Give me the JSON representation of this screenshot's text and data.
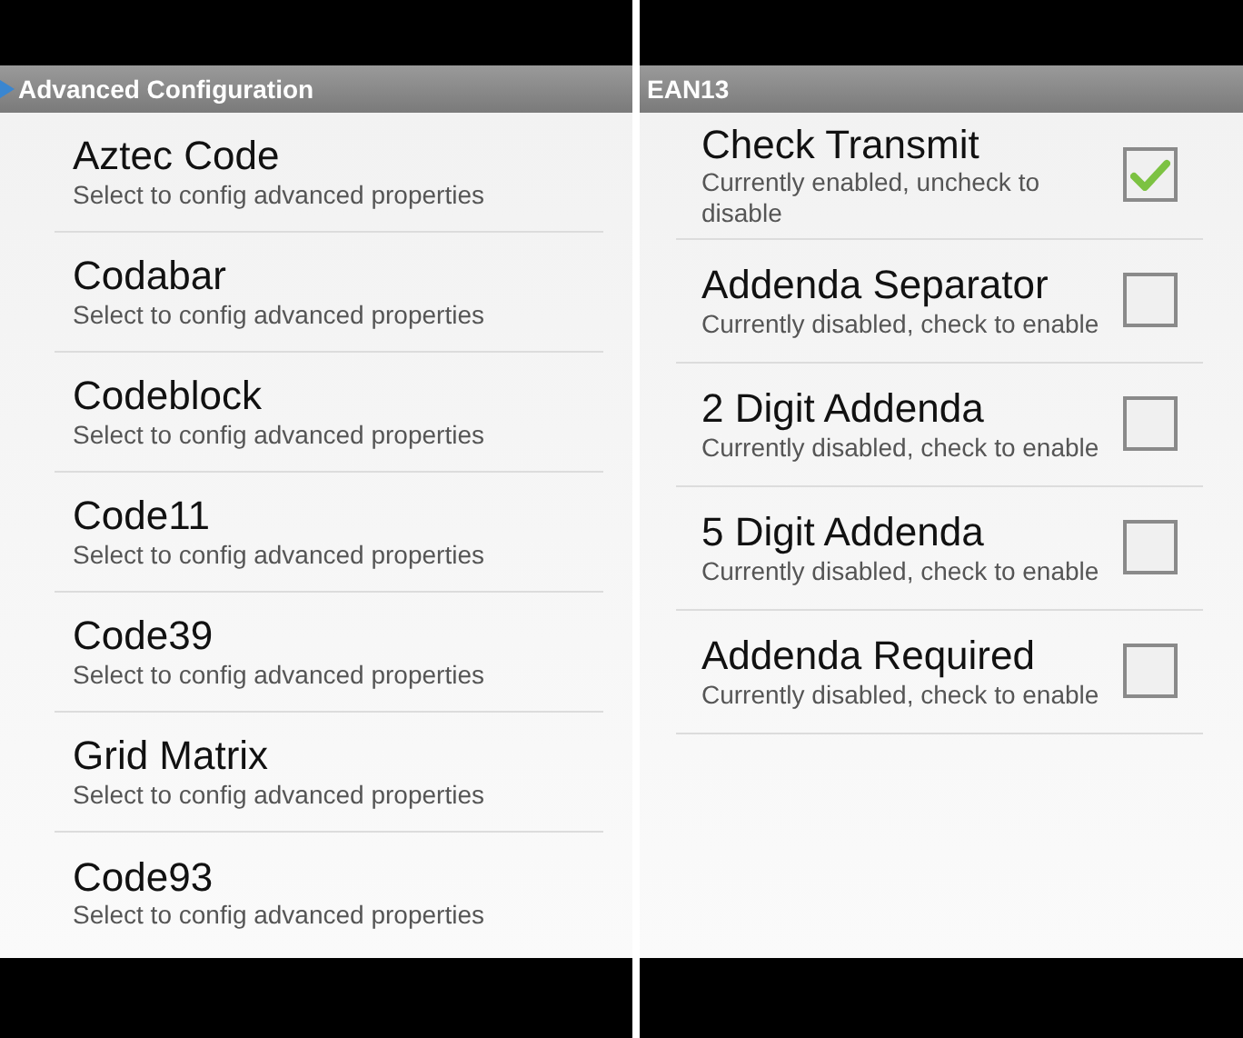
{
  "left_screen": {
    "title": "Advanced Configuration",
    "items": [
      {
        "title": "Aztec Code",
        "subtitle": "Select to config advanced properties"
      },
      {
        "title": "Codabar",
        "subtitle": "Select to config advanced properties"
      },
      {
        "title": "Codeblock",
        "subtitle": "Select to config advanced properties"
      },
      {
        "title": "Code11",
        "subtitle": "Select to config advanced properties"
      },
      {
        "title": "Code39",
        "subtitle": "Select to config advanced properties"
      },
      {
        "title": "Grid Matrix",
        "subtitle": "Select to config advanced properties"
      },
      {
        "title": "Code93",
        "subtitle": "Select to config advanced properties"
      }
    ]
  },
  "right_screen": {
    "title": "EAN13",
    "items": [
      {
        "title": "Check Transmit",
        "subtitle": "Currently enabled, uncheck to disable",
        "checked": true
      },
      {
        "title": "Addenda Separator",
        "subtitle": "Currently disabled, check to enable",
        "checked": false
      },
      {
        "title": "2 Digit Addenda",
        "subtitle": "Currently disabled, check to enable",
        "checked": false
      },
      {
        "title": "5 Digit Addenda",
        "subtitle": "Currently disabled, check to enable",
        "checked": false
      },
      {
        "title": "Addenda Required",
        "subtitle": "Currently disabled, check to enable",
        "checked": false
      }
    ]
  }
}
